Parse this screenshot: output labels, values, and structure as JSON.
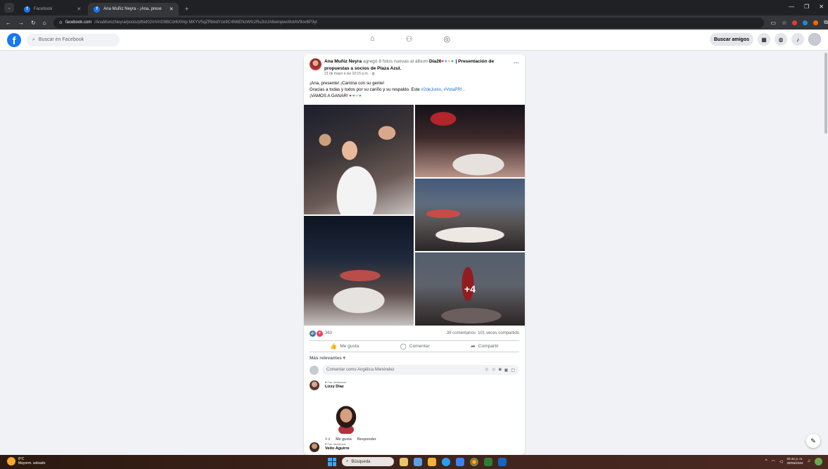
{
  "browser": {
    "tabs": [
      {
        "title": "Facebook",
        "active": false
      },
      {
        "title": "Ana Muñiz Neyra - ¡Ana, prese",
        "active": true
      }
    ],
    "new_tab": "+",
    "url_domain": "facebook.com",
    "url_path": "/AnaMunizNeyra/posts/pfbid02mVnD9BCdr6Xhkp MKYV5qZRbbdYze9C4N6ENzWfc2Ru3sUA6wmpwo9otAV9ov6P3yl"
  },
  "fb_header": {
    "logo": "f",
    "search_placeholder": "Buscar en Facebook",
    "find_friends": "Buscar amigos"
  },
  "post": {
    "author": "Ana Muñiz Neyra",
    "action_text": " agregó 8 fotos nuevas al álbum ",
    "album_prefix": "Día26",
    "album_suffix": " | Presentación de propuestas a socios de Plaza Azul.",
    "timestamp": "23 de mayo a las 10:15 p.m. · ",
    "more": "···",
    "line1": "¡Ana, presente! ¡Camina con su gente!",
    "line2_pre": "Gracias a todas y todos por su cariño y su respaldo. Este ",
    "hashtag1": "#2deJunio",
    "line2_sep": ", ",
    "hashtag2": "#VotaPRI",
    "line2_end": " .",
    "line3": "¡VAMOS A GANAR! ",
    "more_photos": "+4",
    "reactions_count": "363",
    "comments_count": "39 comentarios",
    "shares_count": "101 veces compartido",
    "like_label": "Me gusta",
    "comment_label": "Comentar",
    "share_label": "Compartir",
    "sort_label": "Más relevantes ▾",
    "comment_placeholder": "Comentar como Angélica Menéndez"
  },
  "comments": [
    {
      "badge": "Fan destacado",
      "name": "Lizzy Diaz",
      "age": "4 d",
      "like": "Me gusta",
      "reply": "Responder"
    },
    {
      "badge": "Fan destacado",
      "name": "Veito Aguirre"
    }
  ],
  "taskbar": {
    "temp": "8°C",
    "weather": "Mayorm. soleado",
    "search": "Búsqueda",
    "time": "03:41 p. m.",
    "date": "28/05/2024"
  },
  "colors": {
    "fb_blue": "#1877f2",
    "link_blue": "#216fdb",
    "page_bg": "#f0f2f5"
  }
}
